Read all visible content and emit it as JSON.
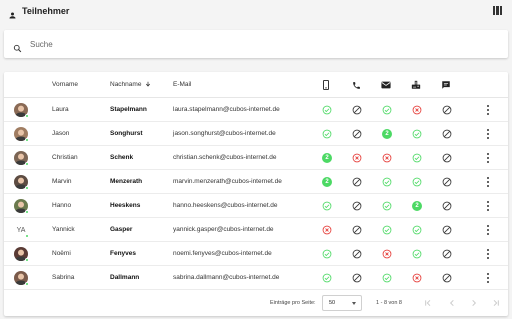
{
  "header": {
    "title": "Teilnehmer",
    "user_icon": "person-icon",
    "columns_icon": "view-columns-icon"
  },
  "search": {
    "placeholder": "Suche",
    "value": ""
  },
  "table": {
    "columns": {
      "vorname": "Vorname",
      "nachname": "Nachname",
      "email": "E-Mail",
      "sort_icon": "arrow-down-icon",
      "channel_icons": [
        "smartphone-icon",
        "phone-icon",
        "mail-icon",
        "fax-icon",
        "chat-icon"
      ]
    },
    "rows": [
      {
        "vorname": "Laura",
        "nachname": "Stapelmann",
        "email": "laura.stapelmann@cubos-internet.de",
        "avatar": "photo",
        "status": [
          "check",
          "block",
          "check",
          "cross",
          "block"
        ]
      },
      {
        "vorname": "Jason",
        "nachname": "Songhurst",
        "email": "jason.songhurst@cubos-internet.de",
        "avatar": "photo",
        "status": [
          "check",
          "block",
          "2",
          "check",
          "block"
        ]
      },
      {
        "vorname": "Christian",
        "nachname": "Schenk",
        "email": "christian.schenk@cubos-internet.de",
        "avatar": "photo",
        "status": [
          "2",
          "cross",
          "cross",
          "check",
          "block"
        ]
      },
      {
        "vorname": "Marvin",
        "nachname": "Menzerath",
        "email": "marvin.menzerath@cubos-internet.de",
        "avatar": "photo",
        "status": [
          "2",
          "block",
          "check",
          "check",
          "block"
        ]
      },
      {
        "vorname": "Hanno",
        "nachname": "Heeskens",
        "email": "hanno.heeskens@cubos-internet.de",
        "avatar": "photo",
        "status": [
          "check",
          "block",
          "check",
          "2",
          "block"
        ]
      },
      {
        "vorname": "Yannick",
        "nachname": "Gasper",
        "email": "yannick.gasper@cubos-internet.de",
        "avatar": "YA",
        "status": [
          "cross",
          "block",
          "check",
          "check",
          "block"
        ]
      },
      {
        "vorname": "Noëmi",
        "nachname": "Fenyves",
        "email": "noemi.fenyves@cubos-internet.de",
        "avatar": "photo",
        "status": [
          "check",
          "block",
          "cross",
          "check",
          "block"
        ]
      },
      {
        "vorname": "Sabrina",
        "nachname": "Dallmann",
        "email": "sabrina.dallmann@cubos-internet.de",
        "avatar": "photo",
        "status": [
          "check",
          "block",
          "check",
          "cross",
          "block"
        ]
      }
    ]
  },
  "footer": {
    "rows_per_page_label": "Einträge pro Seite:",
    "rows_per_page_value": "50",
    "range_label": "1 - 8 von 8"
  },
  "colors": {
    "success": "#4cd964",
    "error": "#e53935",
    "neutral": "#333333",
    "online": "#4cd964"
  }
}
